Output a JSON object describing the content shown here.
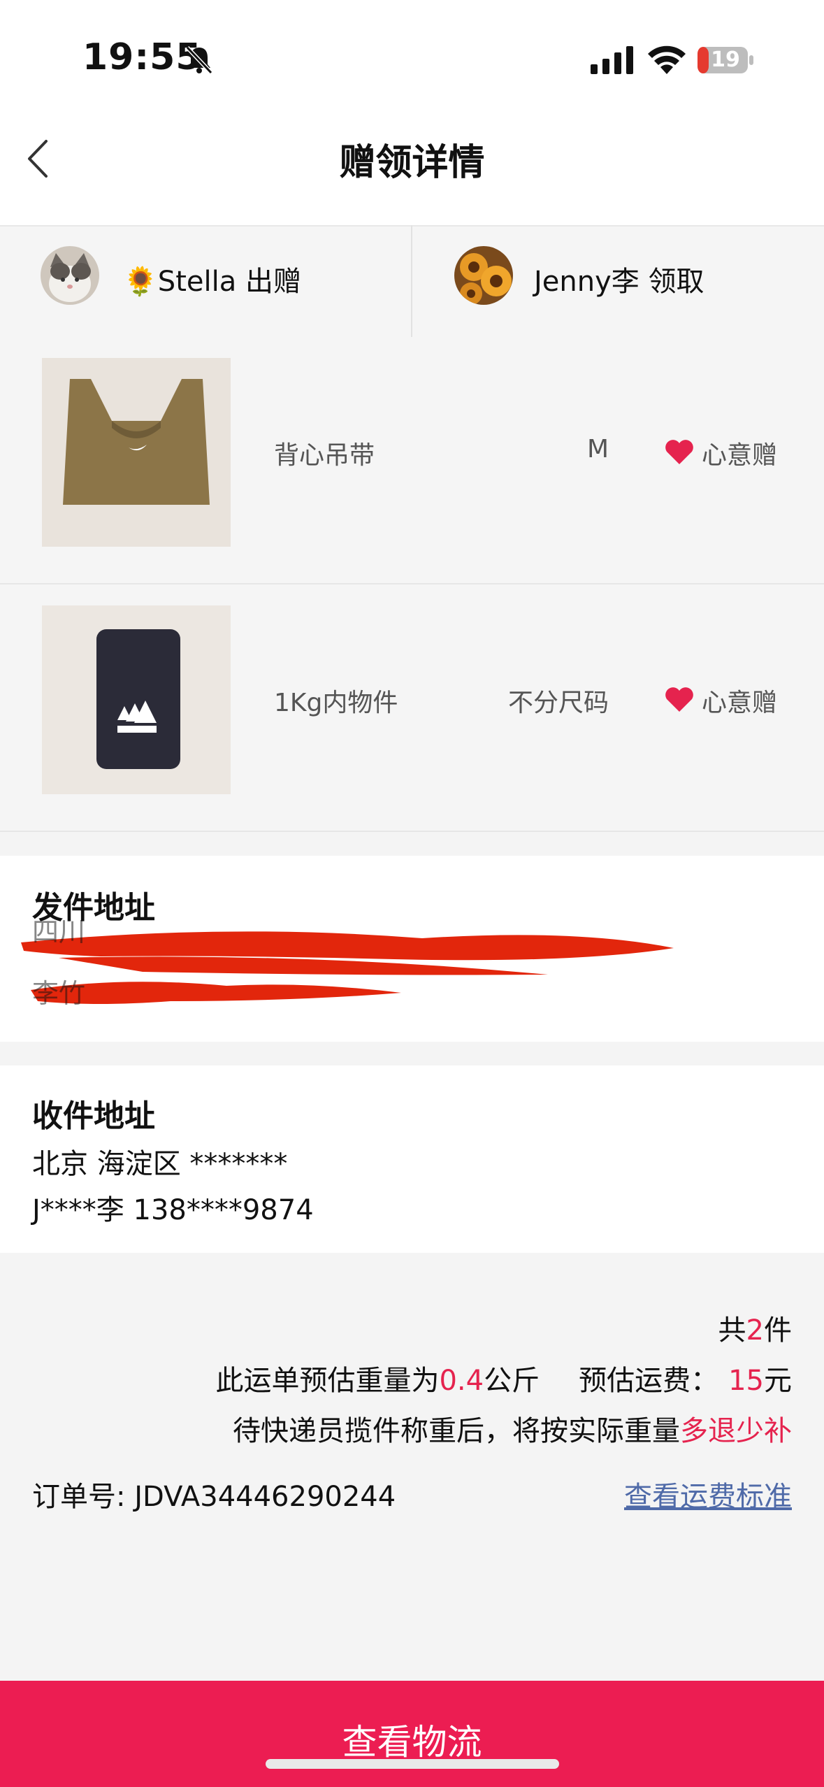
{
  "status_bar": {
    "time": "19:55",
    "battery": "19"
  },
  "header": {
    "title": "赠领详情"
  },
  "giver": {
    "name": "🌻Stella 出赠"
  },
  "receiver": {
    "name": "Jenny李 领取"
  },
  "items": [
    {
      "name": "背心吊带",
      "size": "M",
      "gift_type": "心意赠"
    },
    {
      "name": "1Kg内物件",
      "size": "不分尺码",
      "gift_type": "心意赠"
    }
  ],
  "sender_address": {
    "title": "发件地址"
  },
  "receiver_address": {
    "title": "收件地址",
    "line1": "北京 海淀区 *******",
    "line2": "J****李 138****9874"
  },
  "summary": {
    "count_prefix": "共",
    "count": "2",
    "count_suffix": "件",
    "weight_prefix": "此运单预估重量为",
    "weight": "0.4",
    "weight_unit": "公斤",
    "fee_prefix": "预估运费：",
    "fee": "15",
    "fee_unit": "元",
    "note_prefix": "待快递员揽件称重后，将按实际重量",
    "note_highlight": "多退少补"
  },
  "order": {
    "label": "订单号: JDVA34446290244",
    "fee_link": "查看运费标准"
  },
  "bottom_button": {
    "label": "查看物流"
  },
  "colors": {
    "accent": "#ec1d52",
    "highlight": "#e5234e",
    "link": "#4f6aa8"
  }
}
